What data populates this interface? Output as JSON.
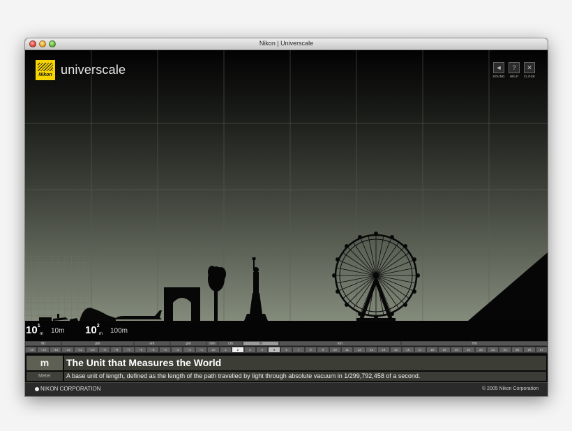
{
  "window": {
    "title": "Nikon | Universcale"
  },
  "header": {
    "logo_text": "Nikon",
    "app_name": "universcale",
    "buttons": [
      {
        "icon": "speaker-icon",
        "glyph": "◄",
        "label": "SOUND"
      },
      {
        "icon": "help-icon",
        "glyph": "?",
        "label": "HELP"
      },
      {
        "icon": "close-icon",
        "glyph": "✕",
        "label": "CLOSE"
      }
    ]
  },
  "scale_labels": [
    {
      "base": "10",
      "exp": "1",
      "unit": "m",
      "length": "10m"
    },
    {
      "base": "10",
      "exp": "2",
      "unit": "m",
      "length": "100m"
    }
  ],
  "ruler": {
    "units": [
      "fm",
      "pm",
      "nm",
      "μm",
      "mm",
      "cm",
      "m",
      "km",
      "Ym"
    ],
    "ticks": [
      "−15",
      "−14",
      "−13",
      "−12",
      "−11",
      "−10",
      "−9",
      "−8",
      "−7",
      "−6",
      "−5",
      "−4",
      "−3",
      "−2",
      "−1",
      "±0",
      "1",
      "2",
      "3",
      "4",
      "5",
      "6",
      "7",
      "8",
      "9",
      "10",
      "11",
      "12",
      "13",
      "14",
      "15",
      "16",
      "17",
      "18",
      "19",
      "20",
      "21",
      "22",
      "23",
      "24",
      "25",
      "26",
      "27"
    ],
    "active_tick": "2",
    "highlight_tick": "5"
  },
  "info": {
    "symbol": "m",
    "symbol_name": "Meter",
    "heading": "The Unit that Measures the World",
    "description": "A base unit of length, defined as the length of the path travelled by light through absolute vacuum in 1/299,792,458 of a second."
  },
  "footer": {
    "left": "NIKON CORPORATION",
    "right": "© 2005 Nikon Corporation"
  },
  "colors": {
    "logo": "#f5d400",
    "scene_top": "#020202",
    "scene_bottom": "#8f9786"
  }
}
